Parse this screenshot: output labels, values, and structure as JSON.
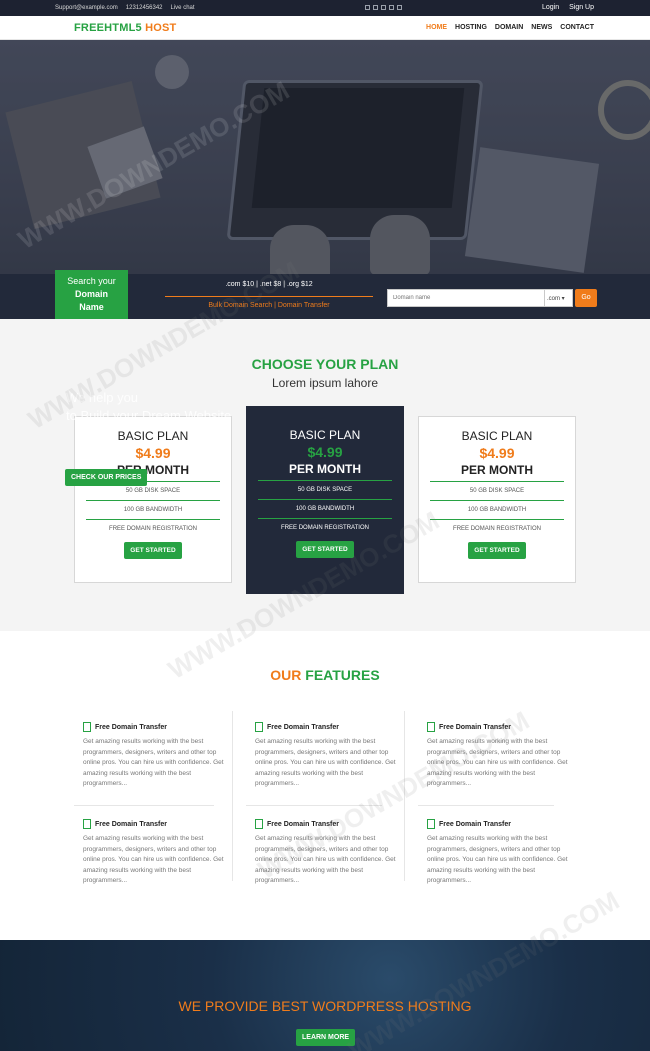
{
  "topbar": {
    "email": "Support@example.com",
    "phone": "12312456342",
    "chat": "Live chat",
    "login": "Login",
    "signup": "Sign Up"
  },
  "nav": {
    "logo_part1": "FREEHTML5",
    "logo_part2": " HOST",
    "items": [
      "HOME",
      "HOSTING",
      "DOMAIN",
      "NEWS",
      "CONTACT"
    ]
  },
  "domain": {
    "tag_line1": "Search your",
    "tag_line2": "Domain",
    "tag_line3": "Name",
    "prices": ".com $10 | .net $8 | .org $12",
    "links": "Bulk Domain Search | Domain Transfer",
    "placeholder": "Domain name",
    "tld": ".com ▾",
    "go": "Go"
  },
  "plans": {
    "title": "CHOOSE YOUR PLAN",
    "subtitle": "Lorem ipsum lahore",
    "overlay_heading1": "We help you",
    "overlay_heading2": "to Build your Dream Website",
    "overlay_button": "CHECK OUR PRICES",
    "cards": [
      {
        "name": "BASIC PLAN",
        "price": "$4.99",
        "period": "PER MONTH",
        "f1": "50 GB DISK SPACE",
        "f2": "100 GB BANDWIDTH",
        "f3": "FREE DOMAIN REGISTRATION",
        "button": "GET STARTED"
      },
      {
        "name": "BASIC PLAN",
        "price": "$4.99",
        "period": "PER MONTH",
        "f1": "50 GB DISK SPACE",
        "f2": "100 GB BANDWIDTH",
        "f3": "FREE DOMAIN REGISTRATION",
        "button": "GET STARTED"
      },
      {
        "name": "BASIC PLAN",
        "price": "$4.99",
        "period": "PER MONTH",
        "f1": "50 GB DISK SPACE",
        "f2": "100 GB BANDWIDTH",
        "f3": "FREE DOMAIN REGISTRATION",
        "button": "GET STARTED"
      }
    ]
  },
  "features": {
    "title_part1": "OUR",
    "title_part2": " FEATURES",
    "items": [
      {
        "title": "Free Domain Transfer",
        "text": "Get amazing results working with the best programmers, designers, writers and other top online pros. You can hire us with confidence. Get amazing results working with the best programmers..."
      },
      {
        "title": "Free Domain Transfer",
        "text": "Get amazing results working with the best programmers, designers, writers and other top online pros. You can hire us with confidence. Get amazing results working with the best programmers..."
      },
      {
        "title": "Free Domain Transfer",
        "text": "Get amazing results working with the best programmers, designers, writers and other top online pros. You can hire us with confidence. Get amazing results working with the best programmers..."
      },
      {
        "title": "Free Domain Transfer",
        "text": "Get amazing results working with the best programmers, designers, writers and other top online pros. You can hire us with confidence. Get amazing results working with the best programmers..."
      },
      {
        "title": "Free Domain Transfer",
        "text": "Get amazing results working with the best programmers, designers, writers and other top online pros. You can hire us with confidence. Get amazing results working with the best programmers..."
      },
      {
        "title": "Free Domain Transfer",
        "text": "Get amazing results working with the best programmers, designers, writers and other top online pros. You can hire us with confidence. Get amazing results working with the best programmers..."
      }
    ]
  },
  "banner": {
    "title": "WE PROVIDE BEST WORDPRESS HOSTING",
    "button": "LEARN MORE"
  },
  "watermark": "WWW.DOWNDEMO.COM",
  "colors": {
    "green": "#27a243",
    "orange": "#f07c1b",
    "dark": "#22293a"
  }
}
